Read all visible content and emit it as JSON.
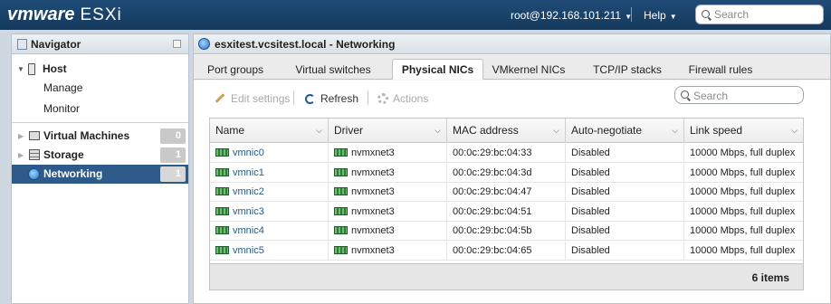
{
  "header": {
    "logo_vm": "vmware",
    "logo_product": "ESXi",
    "user": "root@192.168.101.211",
    "help": "Help",
    "search_placeholder": "Search"
  },
  "navigator": {
    "title": "Navigator",
    "host": "Host",
    "host_children": [
      "Manage",
      "Monitor"
    ],
    "items": [
      {
        "label": "Virtual Machines",
        "count": "0"
      },
      {
        "label": "Storage",
        "count": "1"
      },
      {
        "label": "Networking",
        "count": "1",
        "selected": true
      }
    ]
  },
  "main": {
    "title": "esxitest.vcsitest.local - Networking",
    "tabs": [
      "Port groups",
      "Virtual switches",
      "Physical NICs",
      "VMkernel NICs",
      "TCP/IP stacks",
      "Firewall rules"
    ],
    "active_tab": "Physical NICs",
    "toolbar": {
      "edit_settings": "Edit settings",
      "refresh": "Refresh",
      "actions": "Actions",
      "search_placeholder": "Search"
    },
    "table": {
      "columns": [
        "Name",
        "Driver",
        "MAC address",
        "Auto-negotiate",
        "Link speed"
      ],
      "rows": [
        [
          "vmnic0",
          "nvmxnet3",
          "00:0c:29:bc:04:33",
          "Disabled",
          "10000 Mbps, full duplex"
        ],
        [
          "vmnic1",
          "nvmxnet3",
          "00:0c:29:bc:04:3d",
          "Disabled",
          "10000 Mbps, full duplex"
        ],
        [
          "vmnic2",
          "nvmxnet3",
          "00:0c:29:bc:04:47",
          "Disabled",
          "10000 Mbps, full duplex"
        ],
        [
          "vmnic3",
          "nvmxnet3",
          "00:0c:29:bc:04:51",
          "Disabled",
          "10000 Mbps, full duplex"
        ],
        [
          "vmnic4",
          "nvmxnet3",
          "00:0c:29:bc:04:5b",
          "Disabled",
          "10000 Mbps, full duplex"
        ],
        [
          "vmnic5",
          "nvmxnet3",
          "00:0c:29:bc:04:65",
          "Disabled",
          "10000 Mbps, full duplex"
        ]
      ],
      "footer": "6 items"
    }
  }
}
